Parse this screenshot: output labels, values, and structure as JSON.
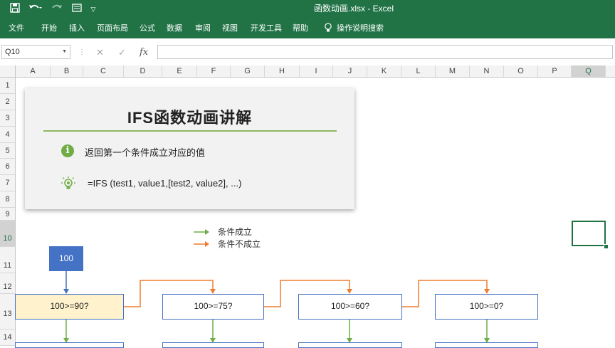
{
  "app": {
    "window_title": "函数动画.xlsx  -  Excel",
    "quick_access": [
      "save-icon",
      "undo-icon",
      "redo-icon",
      "form-icon",
      "customize-icon"
    ]
  },
  "ribbon": {
    "tabs": [
      "文件",
      "开始",
      "插入",
      "页面布局",
      "公式",
      "数据",
      "审阅",
      "视图",
      "开发工具",
      "帮助"
    ],
    "tell_me": "操作说明搜索"
  },
  "formula_bar": {
    "name_box": "Q10",
    "cancel": "✕",
    "enter": "✓",
    "fx": "fx",
    "value": ""
  },
  "sheet": {
    "columns": [
      "A",
      "B",
      "C",
      "D",
      "E",
      "F",
      "G",
      "H",
      "I",
      "J",
      "K",
      "L",
      "M",
      "N",
      "O",
      "P",
      "Q"
    ],
    "rows": [
      "1",
      "2",
      "3",
      "4",
      "5",
      "6",
      "7",
      "8",
      "9",
      "10",
      "11",
      "12",
      "13",
      "14"
    ],
    "selected_column": "Q",
    "selected_row": "10"
  },
  "card": {
    "title": "IFS函数动画讲解",
    "description": "返回第一个条件成立对应的值",
    "syntax": "=IFS (test1, value1,[test2, value2], ...)",
    "accent_color": "#8cb85d"
  },
  "legend": {
    "true_label": "条件成立",
    "false_label": "条件不成立",
    "true_color": "#70ad47",
    "false_color": "#ed7d31"
  },
  "flow": {
    "input_value": "100",
    "conditions": [
      "100>=90?",
      "100>=75?",
      "100>=60?",
      "100>=0?"
    ],
    "active_condition_color": "#fff2cc",
    "box_border_color": "#4472c4"
  }
}
